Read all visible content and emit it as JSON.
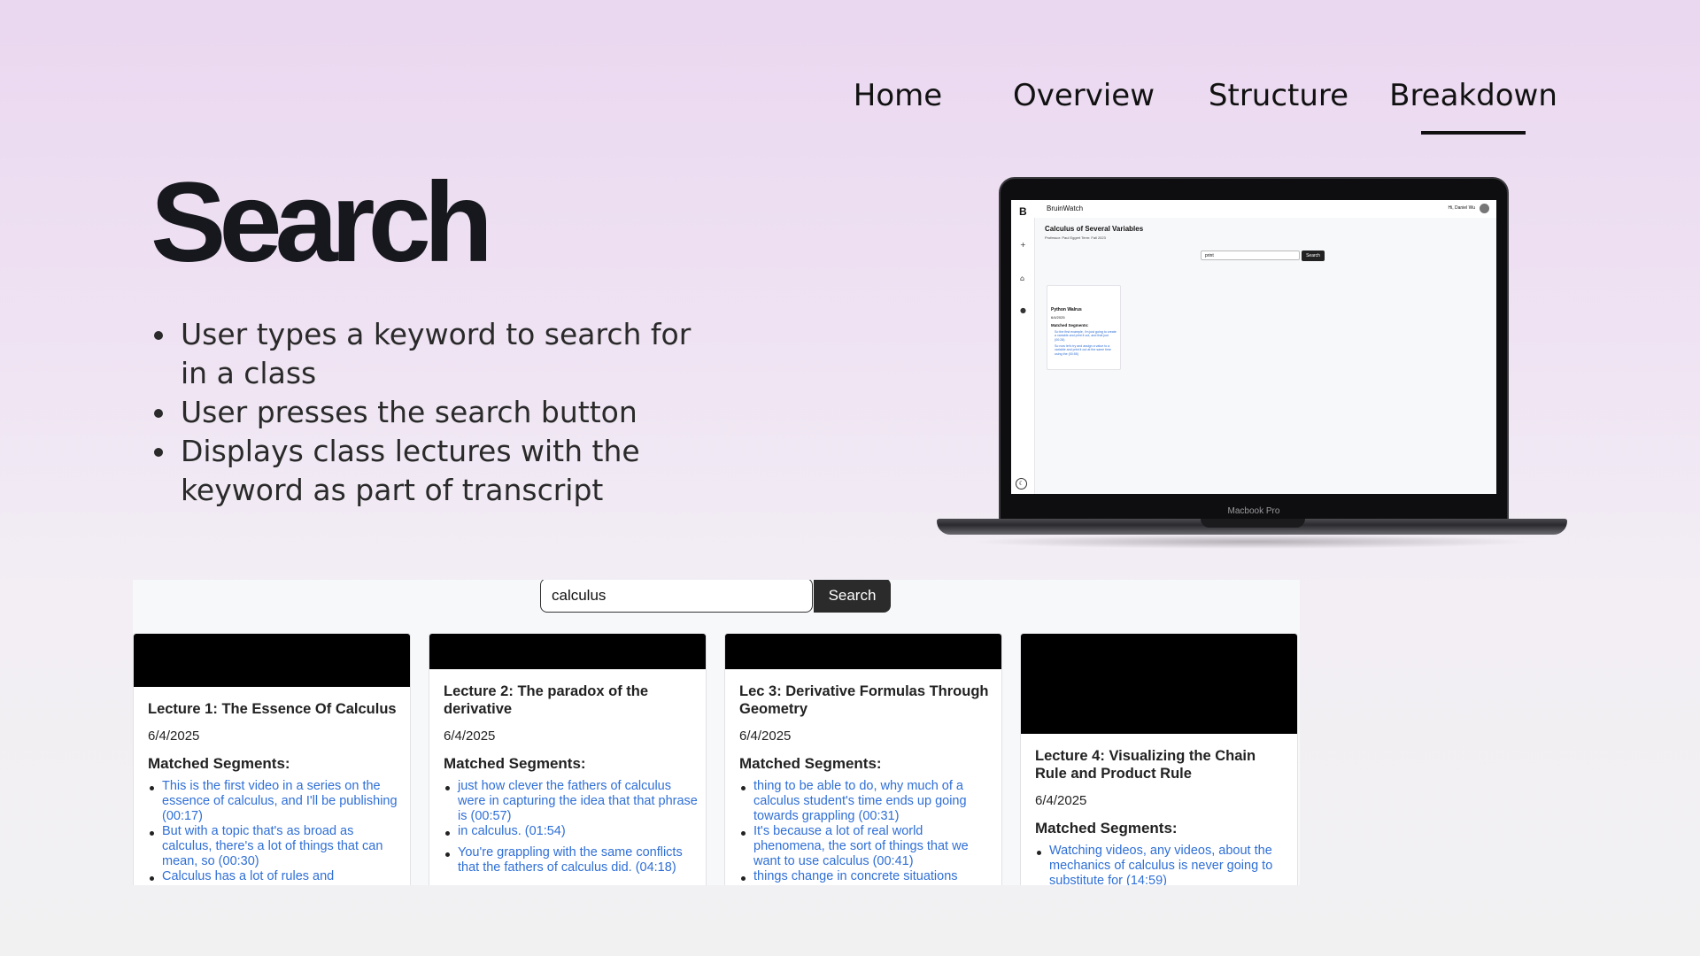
{
  "nav": {
    "items": [
      {
        "label": "Home",
        "active": false
      },
      {
        "label": "Overview",
        "active": false
      },
      {
        "label": "Structure",
        "active": false
      },
      {
        "label": "Breakdown",
        "active": true
      }
    ]
  },
  "title": "Search",
  "bullets": [
    "User types a keyword to search for in a class",
    "User presses the search button",
    "Displays class lectures with the keyword as part of transcript"
  ],
  "laptop": {
    "label": "Macbook Pro",
    "app": {
      "brand": "BruinWatch",
      "user": "Hi, Daniel Wu",
      "course_title": "Calculus of Several Variables",
      "course_meta": "Professor: Paul Eggert     Term: Fall 2023",
      "search_value": "print",
      "search_button": "Search",
      "card": {
        "title": "Python Walrus",
        "date": "6/4/2025",
        "matched_label": "Matched Segments:",
        "segments": [
          "So the first example, I'm just going to create a variable and print it out, and that just (00:28)",
          "So now let's try and assign a value to a variable and print it out at the same time using the (00:55)"
        ]
      }
    }
  },
  "search": {
    "value": "calculus",
    "button_label": "Search"
  },
  "cards": [
    {
      "title": "Lecture 1: The Essence Of Calculus",
      "date": "6/4/2025",
      "matched_label": "Matched Segments:",
      "segments": [
        "This is the first video in a series on the essence of calculus, and I'll be publishing (00:17)",
        "But with a topic that's as broad as calculus, there's a lot of things that can mean, so (00:30)",
        "Calculus has a lot of rules and"
      ]
    },
    {
      "title": "Lecture 2: The paradox of the derivative",
      "date": "6/4/2025",
      "matched_label": "Matched Segments:",
      "segments": [
        "just how clever the fathers of calculus were in capturing the idea that that phrase is (00:57)",
        "in calculus. (01:54)",
        "You're grappling with the same conflicts that the fathers of calculus did. (04:18)"
      ]
    },
    {
      "title": "Lec 3: Derivative Formulas Through Geometry",
      "date": "6/4/2025",
      "matched_label": "Matched Segments:",
      "segments": [
        "thing to be able to do, why much of a calculus student's time ends up going towards grappling (00:31)",
        "It's because a lot of real world phenomena, the sort of things that we want to use calculus (00:41)",
        "things change in concrete situations"
      ]
    },
    {
      "title": "Lecture 4: Visualizing the Chain Rule and Product Rule",
      "date": "6/4/2025",
      "matched_label": "Matched Segments:",
      "segments": [
        "Watching videos, any videos, about the mechanics of calculus is never going to substitute for (14:59)"
      ]
    }
  ]
}
